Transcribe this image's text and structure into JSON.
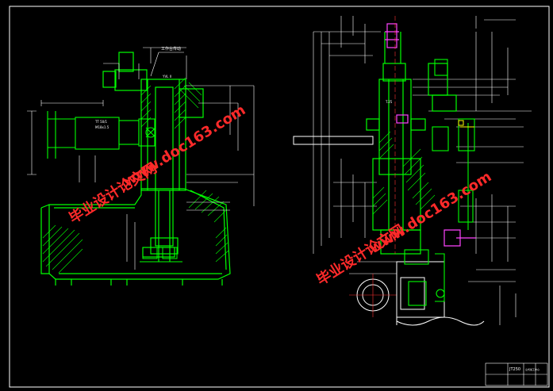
{
  "drawing": {
    "background": "#000000",
    "line_colors": {
      "frame": "#ffffff",
      "outline": "#ffffff",
      "part": "#00ff00",
      "hatch": "#00ff00",
      "dimension": "#ffffff",
      "highlight": "#ff44ff",
      "center": "#ff3333",
      "accent": "#ffff00"
    },
    "left_view": {
      "callout_label": "工作台传动",
      "small_note": "YVL II",
      "text_block_1": "TT 50/1",
      "text_block_2": "M18x1.5"
    },
    "right_view": {
      "side_note": "T.25"
    },
    "title_block": {
      "title": "JT250",
      "subtitle": "立式加工中心"
    }
  },
  "watermarks": [
    {
      "text": "毕业设计论文网",
      "color": "#ff2a2a"
    },
    {
      "text": "www.doc163.com",
      "color": "#ff2a2a"
    },
    {
      "text": "毕业设计论文网",
      "color": "#ff2a2a"
    },
    {
      "text": "www.doc163.com",
      "color": "#ff2a2a"
    }
  ]
}
